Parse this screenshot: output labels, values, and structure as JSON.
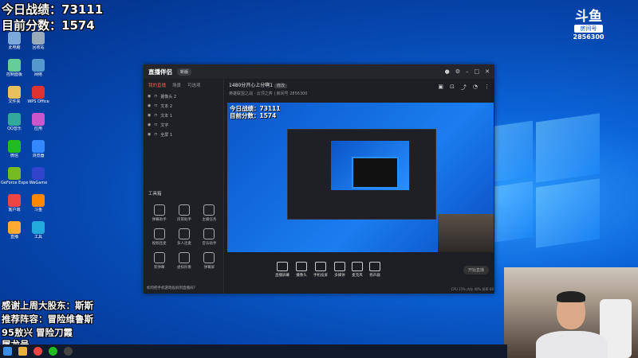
{
  "overlay": {
    "line1": "今日战绩：73111",
    "line2": "目前分数：1574",
    "thanks": "感谢上周大股东：斯斯",
    "recommend": "推荐阵容：冒险维鲁斯",
    "combo": "95敖兴 冒险刀霞",
    "tulong": "屠龙号"
  },
  "douyu": {
    "logo": "斗鱼",
    "room_label": "房间号",
    "room_number": "2856300"
  },
  "desktop_icons": [
    {
      "label": "此电脑",
      "color": "#7aa8d8"
    },
    {
      "label": "回收站",
      "color": "#9ab"
    },
    {
      "label": "控制面板",
      "color": "#6c9"
    },
    {
      "label": "网络",
      "color": "#59c"
    },
    {
      "label": "文件夹",
      "color": "#e8c15a"
    },
    {
      "label": "WPS Office",
      "color": "#d33"
    },
    {
      "label": "QQ音乐",
      "color": "#3a9"
    },
    {
      "label": "应用",
      "color": "#c5c"
    },
    {
      "label": "微信",
      "color": "#2b2"
    },
    {
      "label": "浏览器",
      "color": "#38f"
    },
    {
      "label": "GeForce Experience",
      "color": "#7b2"
    },
    {
      "label": "WeGame",
      "color": "#34c"
    },
    {
      "label": "客户端",
      "color": "#e44"
    },
    {
      "label": "斗鱼",
      "color": "#f80"
    },
    {
      "label": "直播",
      "color": "#fa3"
    },
    {
      "label": "工具",
      "color": "#2ad"
    }
  ],
  "app": {
    "brand": "直播伴侣",
    "version": "新版",
    "tabs": [
      "我的直播",
      "场景",
      "可选项"
    ],
    "sources": [
      "摄像头 2",
      "文本 2",
      "文本 1",
      "文字",
      "全屏 1"
    ],
    "tools_title": "工具箱",
    "tools": [
      "弹幕助手",
      "房管助手",
      "主播任务",
      "视频连麦",
      "多人连麦",
      "音乐助手",
      "装弹幕",
      "虚拟形象",
      "弹幕屏"
    ],
    "notice": "如何把手机游戏投屏到直播间?",
    "room_title": "1480分开心上分啊1",
    "room_tag": "修改",
    "room_meta": "英雄联盟之战 · 云顶之弈   |   房间号 2856300",
    "preview_line1": "今日战绩：73111",
    "preview_line2": "目前分数：1574",
    "controls": [
      "直播屏幕",
      "摄像头",
      "手机投屏",
      "多媒体",
      "麦克风",
      "扬声器"
    ],
    "start_button": "开始直播",
    "status": "CPU 15%   内存 40%   帧率 60"
  },
  "taskbar": {
    "apps": [
      "start",
      "file-explorer",
      "chrome",
      "wechat",
      "obs"
    ]
  }
}
